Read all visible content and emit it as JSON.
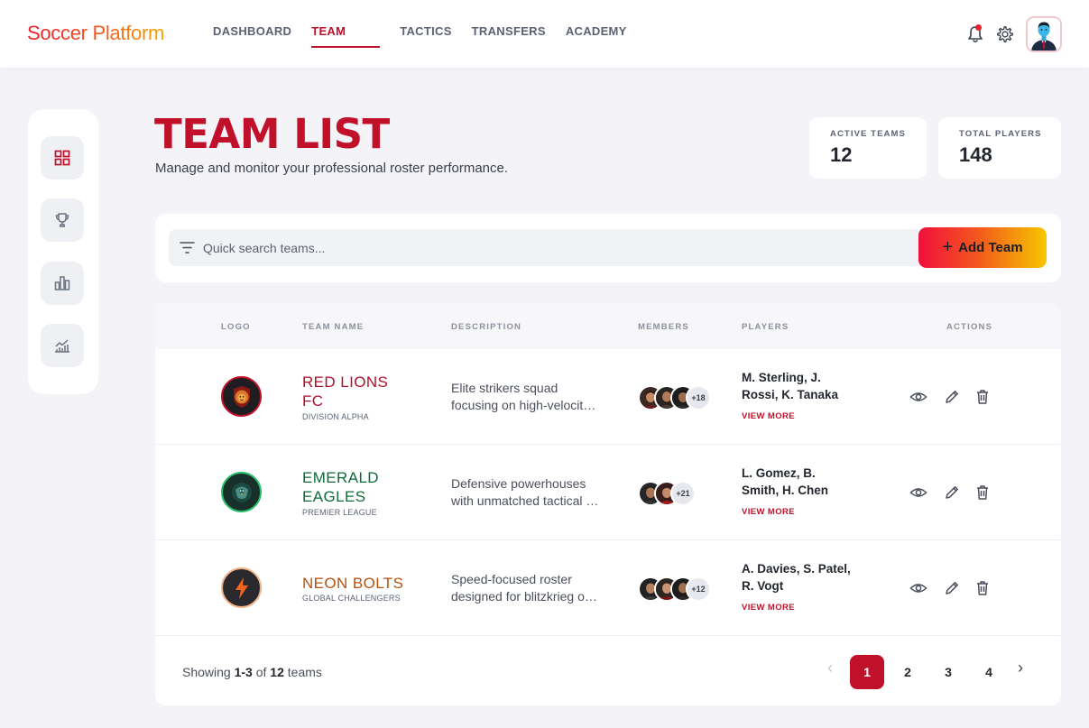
{
  "app": {
    "brand": "Soccer Platform",
    "nav": [
      "DASHBOARD",
      "TEAM",
      "TACTICS",
      "TRANSFERS",
      "ACADEMY"
    ],
    "active_nav": "TEAM"
  },
  "colors": {
    "accent": "#c0102a",
    "page_bg": "#f4f4f8"
  },
  "sidebar": {
    "items": [
      {
        "icon": "grid-icon",
        "active": true
      },
      {
        "icon": "trophy-icon",
        "active": false
      },
      {
        "icon": "bar-chart-icon",
        "active": false
      },
      {
        "icon": "line-chart-icon",
        "active": false
      }
    ]
  },
  "header": {
    "title": "TEAM LIST",
    "subtitle": "Manage and monitor your professional roster performance."
  },
  "stats": {
    "active_label": "ACTIVE TEAMS",
    "active_value": "12",
    "players_label": "TOTAL PLAYERS",
    "players_value": "148"
  },
  "search": {
    "placeholder": "Quick search teams...",
    "add_label": "Add Team"
  },
  "table": {
    "columns": [
      "LOGO",
      "TEAM NAME",
      "DESCRIPTION",
      "MEMBERS",
      "PLAYERS",
      "ACTIONS"
    ],
    "rows": [
      {
        "name_line1": "RED LIONS",
        "name_line2": "FC",
        "league": "DIVISION ALPHA",
        "desc_line1": "Elite strikers squad",
        "desc_line2": "focusing on high-velocity attack",
        "members_extra": "+18",
        "players_line1": "M. Sterling, J.",
        "players_line2": "Rossi, K. Tanaka",
        "view_more": "VIEW MORE",
        "color": "#b0102a"
      },
      {
        "name_line1": "EMERALD",
        "name_line2": "EAGLES",
        "league": "PREMIER LEAGUE",
        "desc_line1": "Defensive powerhouses",
        "desc_line2": "with unmatched tactical discipline",
        "members_extra": "+21",
        "players_line1": "L. Gomez, B.",
        "players_line2": "Smith, H. Chen",
        "view_more": "VIEW MORE",
        "color": "#0f6b3a"
      },
      {
        "name_line1": "NEON BOLTS",
        "name_line2": "",
        "league": "GLOBAL CHALLENGERS",
        "desc_line1": "Speed-focused roster",
        "desc_line2": "designed for blitzkrieg offense",
        "members_extra": "+12",
        "players_line1": "A. Davies, S. Patel,",
        "players_line2": "R. Vogt",
        "view_more": "VIEW MORE",
        "color": "#b5520e"
      }
    ]
  },
  "footer": {
    "showing_prefix": "Showing",
    "showing_range": "1-3",
    "showing_of": "of",
    "showing_total": "12",
    "showing_suffix": "teams",
    "pages": [
      "1",
      "2",
      "3",
      "4"
    ],
    "current_page": "1"
  }
}
